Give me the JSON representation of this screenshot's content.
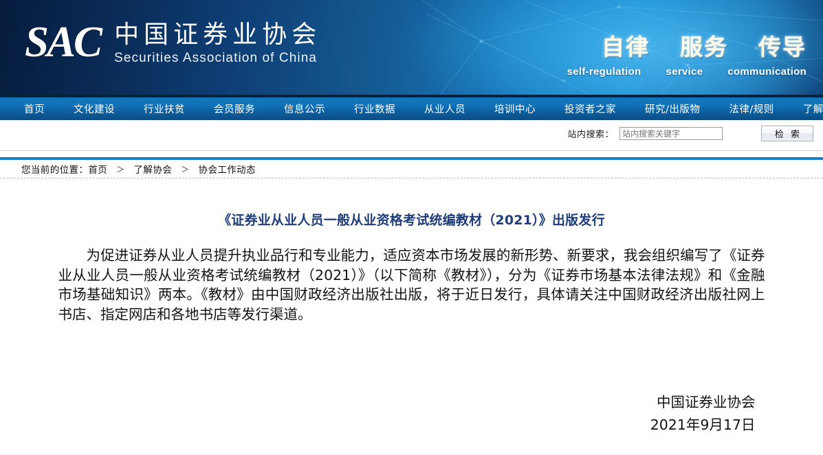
{
  "header": {
    "logo_mark": "SAC",
    "org_cn": "中国证券业协会",
    "org_en": "Securities Association of China",
    "slogan_cn": [
      "自律",
      "服务",
      "传导"
    ],
    "slogan_en": [
      "self-regulation",
      "service",
      "communication"
    ]
  },
  "nav": {
    "items": [
      {
        "label": "首页"
      },
      {
        "label": "文化建设"
      },
      {
        "label": "行业扶贫"
      },
      {
        "label": "会员服务"
      },
      {
        "label": "信息公示"
      },
      {
        "label": "行业数据"
      },
      {
        "label": "从业人员"
      },
      {
        "label": "培训中心"
      },
      {
        "label": "投资者之家"
      },
      {
        "label": "研究/出版物"
      },
      {
        "label": "法律/规则"
      },
      {
        "label": "了解协会"
      }
    ]
  },
  "search": {
    "label": "站内搜索：",
    "placeholder": "站内搜索关键字",
    "value": "",
    "button_label": "检 索"
  },
  "breadcrumb": {
    "prefix": "您当前的位置：",
    "separator": "＞",
    "items": [
      "首页",
      "了解协会",
      "协会工作动态"
    ]
  },
  "article": {
    "title": "《证券业从业人员一般从业资格考试统编教材（2021）》出版发行",
    "body": "为促进证券从业人员提升执业品行和专业能力，适应资本市场发展的新形势、新要求，我会组织编写了《证券业从业人员一般从业资格考试统编教材（2021）》（以下简称《教材》），分为《证券市场基本法律法规》和《金融市场基础知识》两本。《教材》由中国财政经济出版社出版，将于近日发行，具体请关注中国财政经济出版社网上书店、指定网店和各地书店等发行渠道。",
    "signature_org": "中国证券业协会",
    "signature_date": "2021年9月17日"
  },
  "colors": {
    "nav_blue": "#0d5fa0",
    "accent_rule": "#1b7fc4",
    "title_blue": "#1f3d7a",
    "banner_dark": "#061c3d",
    "banner_light": "#2aa3e0"
  }
}
